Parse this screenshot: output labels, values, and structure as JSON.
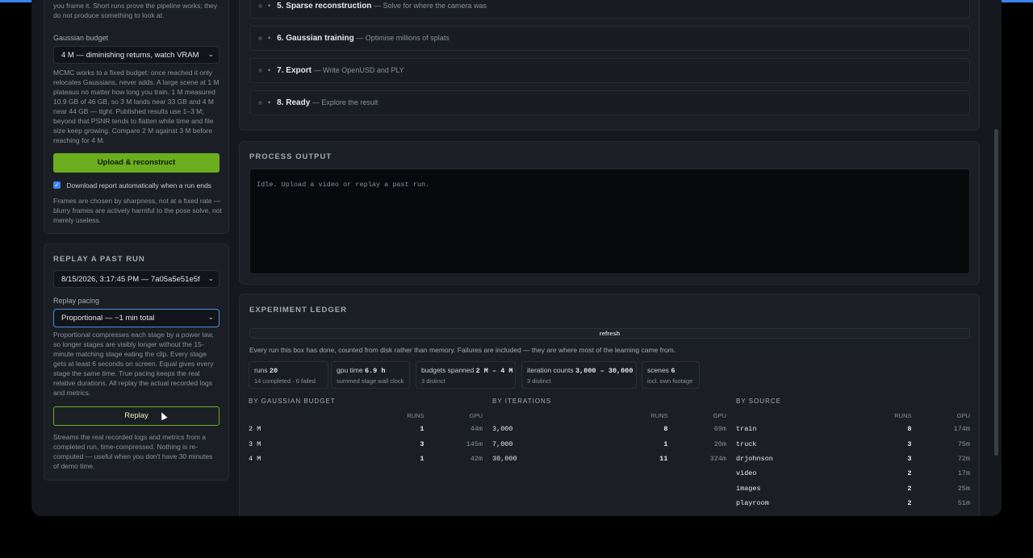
{
  "left": {
    "intro_text_line1": "you frame it. Short runs prove the pipeline works; they",
    "intro_text_line2": "do not produce something to look at.",
    "gaussian_budget": {
      "label": "Gaussian budget",
      "value": "4 M — diminishing returns, watch VRAM",
      "help": "MCMC works to a fixed budget: once reached it only relocates Gaussians, never adds. A large scene at 1 M plateaus no matter how long you train. 1 M measured 10.9 GB of 46 GB, so 3 M lands near 33 GB and 4 M near 44 GB — tight. Published results use 1–3 M; beyond that PSNR tends to flatten while time and file size keep growing. Compare 2 M against 3 M before reaching for 4 M."
    },
    "upload_button": "Upload & reconstruct",
    "download_checkbox": {
      "label": "Download report automatically when a run ends",
      "checked": true
    },
    "frames_note": "Frames are chosen by sharpness, not at a fixed rate — blurry frames are actively harmful to the pose solve, not merely useless.",
    "replay": {
      "title": "REPLAY A PAST RUN",
      "run_value": "8/15/2026, 3:17:45 PM — 7a05a5e51e5f",
      "pacing_label": "Replay pacing",
      "pacing_value": "Proportional — ~1 min total",
      "pacing_help": "Proportional compresses each stage by a power law, so longer stages are visibly longer without the 15-minute matching stage eating the clip. Every stage gets at least 6 seconds on screen. Equal gives every stage the same time. True pacing keeps the real relative durations. All replay the actual recorded logs and metrics.",
      "button": "Replay",
      "note": "Streams the real recorded logs and metrics from a completed run, time-compressed. Nothing is re-computed — useful when you don't have 30 minutes of demo time."
    }
  },
  "stages": [
    {
      "title": "5. Sparse reconstruction",
      "desc": "— Solve for where the camera was"
    },
    {
      "title": "6. Gaussian training",
      "desc": "— Optimise millions of splats"
    },
    {
      "title": "7. Export",
      "desc": "— Write OpenUSD and PLY"
    },
    {
      "title": "8. Ready",
      "desc": "— Explore the result"
    }
  ],
  "process": {
    "title": "PROCESS OUTPUT",
    "text": "Idle. Upload a video or replay a past run."
  },
  "ledger": {
    "title": "EXPERIMENT LEDGER",
    "refresh": "refresh",
    "desc": "Every run this box has done, counted from disk rather than memory. Failures are included — they are where most of the learning came from.",
    "stats": [
      {
        "label": "runs",
        "value": "20",
        "sub": "14 completed · 6 failed"
      },
      {
        "label": "gpu time",
        "value": "6.9 h",
        "sub": "summed stage wall clock"
      },
      {
        "label": "budgets spanned",
        "value": "2 M – 4 M",
        "sub": "3 distinct"
      },
      {
        "label": "iteration counts",
        "value": "3,000 – 30,000",
        "sub": "3 distinct"
      },
      {
        "label": "scenes",
        "value": "6",
        "sub": "incl. own footage"
      }
    ],
    "tables": [
      {
        "title": "BY GAUSSIAN BUDGET",
        "col_runs": "RUNS",
        "col_gpu": "GPU",
        "rows": [
          {
            "key": "2 M",
            "runs": "1",
            "gpu": "44m"
          },
          {
            "key": "3 M",
            "runs": "3",
            "gpu": "145m"
          },
          {
            "key": "4 M",
            "runs": "1",
            "gpu": "42m"
          }
        ]
      },
      {
        "title": "BY ITERATIONS",
        "col_runs": "RUNS",
        "col_gpu": "GPU",
        "rows": [
          {
            "key": "3,000",
            "runs": "8",
            "gpu": "69m"
          },
          {
            "key": "7,000",
            "runs": "1",
            "gpu": "20m"
          },
          {
            "key": "30,000",
            "runs": "11",
            "gpu": "324m"
          }
        ]
      },
      {
        "title": "BY SOURCE",
        "col_runs": "RUNS",
        "col_gpu": "GPU",
        "rows": [
          {
            "key": "train",
            "runs": "8",
            "gpu": "174m"
          },
          {
            "key": "truck",
            "runs": "3",
            "gpu": "75m"
          },
          {
            "key": "drjohnson",
            "runs": "3",
            "gpu": "72m"
          },
          {
            "key": "video",
            "runs": "2",
            "gpu": "17m"
          },
          {
            "key": "images",
            "runs": "2",
            "gpu": "25m"
          },
          {
            "key": "playroom",
            "runs": "2",
            "gpu": "51m"
          }
        ]
      }
    ]
  },
  "colors": {
    "accent_green": "#6aad1f",
    "focus_blue": "#4a90e2",
    "top_bar": "#3b82f6"
  }
}
